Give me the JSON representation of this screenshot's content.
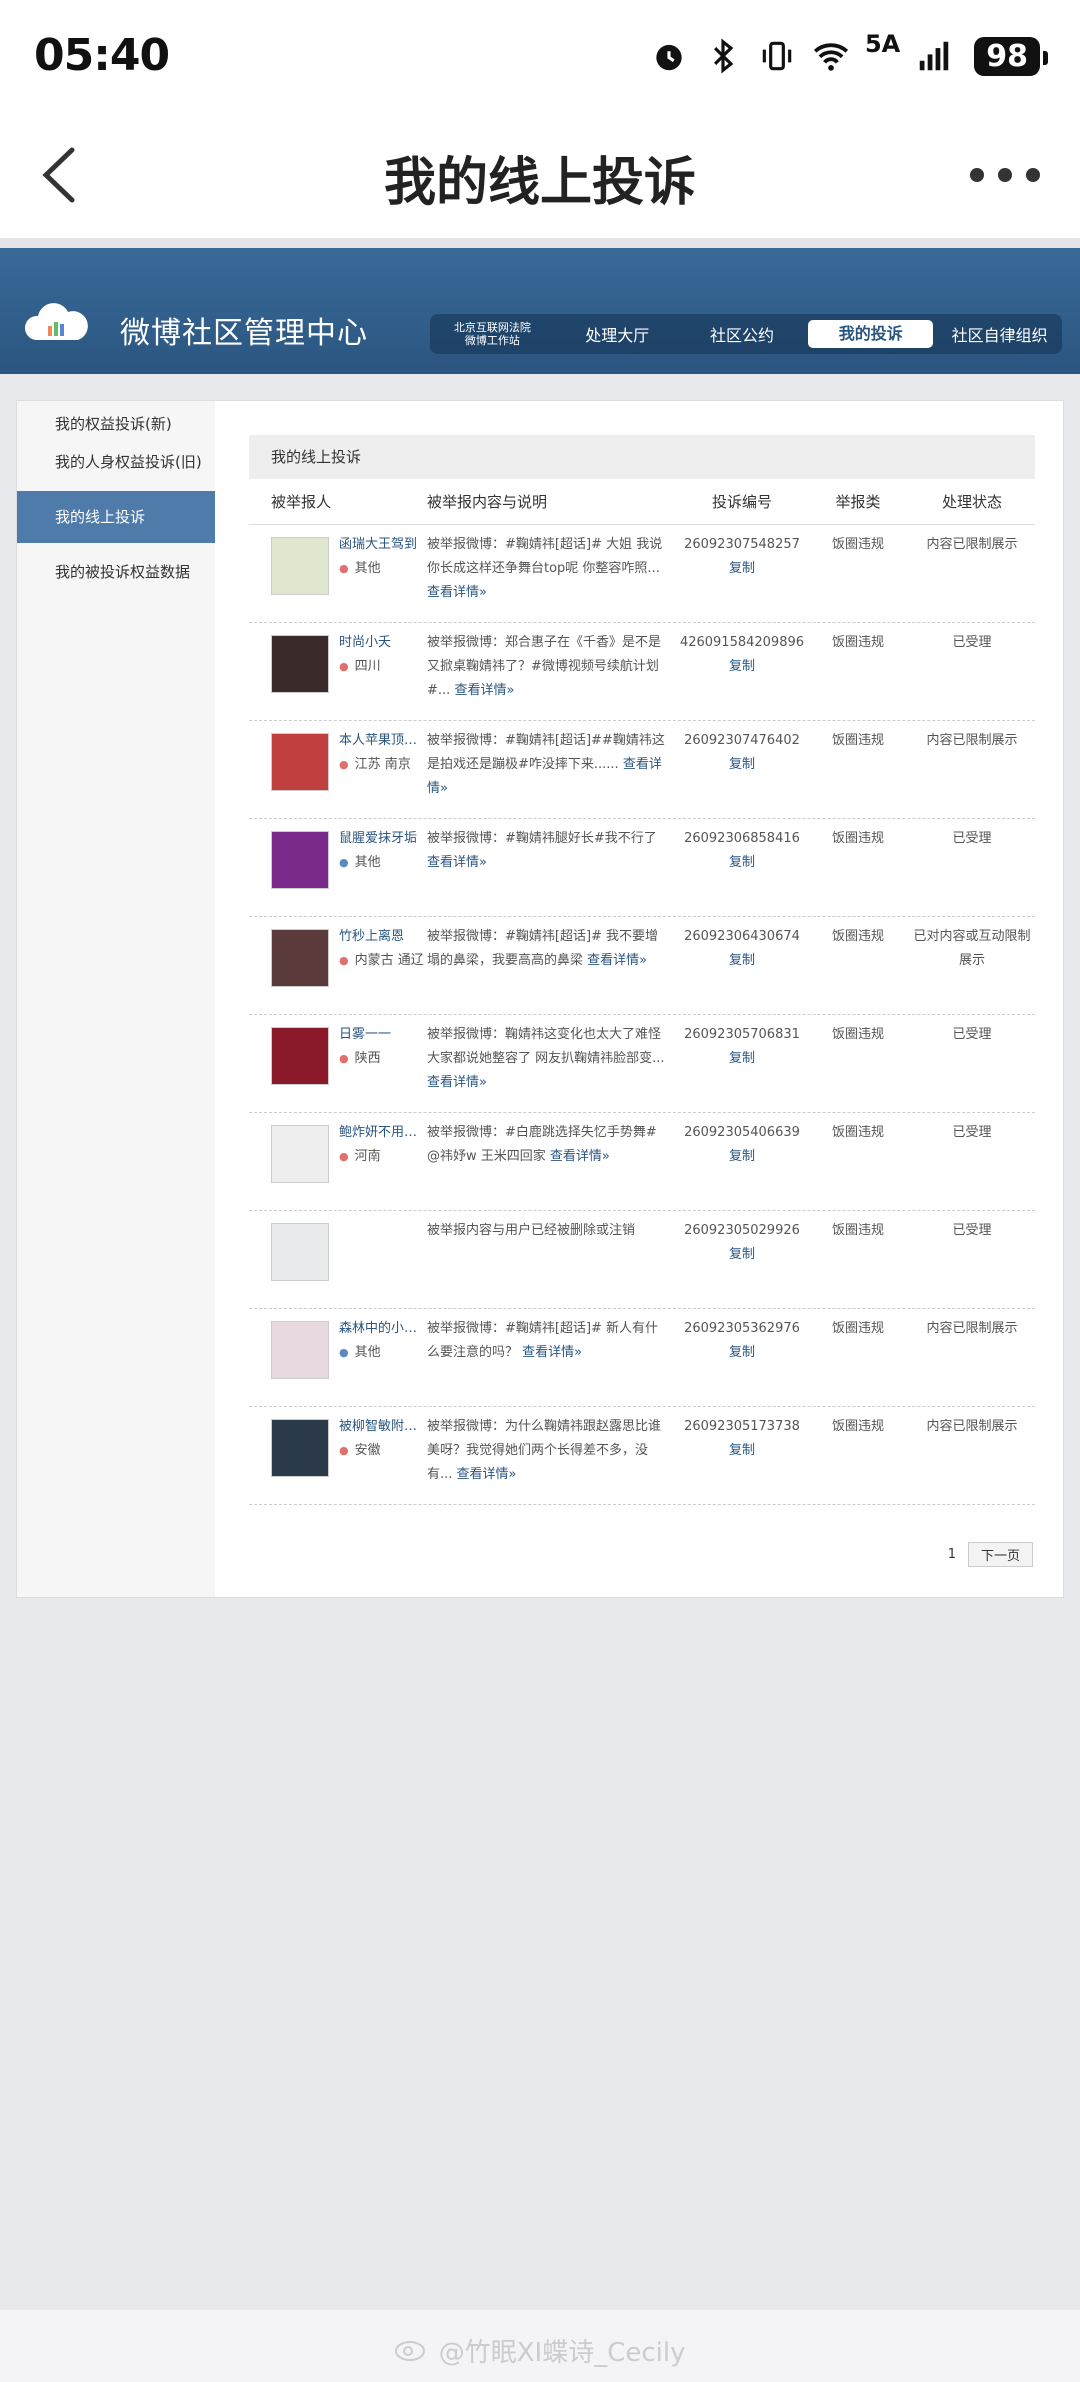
{
  "status": {
    "time": "05:40",
    "network": "5A",
    "battery": "98"
  },
  "nav": {
    "title": "我的线上投诉"
  },
  "web": {
    "title": "微博社区管理中心",
    "menu": [
      {
        "label_line1": "北京互联网法院",
        "label_line2": "微博工作站"
      },
      {
        "label": "处理大厅"
      },
      {
        "label": "社区公约"
      },
      {
        "label": "我的投诉"
      },
      {
        "label": "社区自律组织"
      }
    ]
  },
  "sidebar": {
    "items": [
      {
        "label": "我的权益投诉(新)"
      },
      {
        "label": "我的人身权益投诉(旧)"
      },
      {
        "label": "我的线上投诉"
      },
      {
        "label": "我的被投诉权益数据"
      }
    ]
  },
  "main": {
    "heading": "我的线上投诉",
    "columns": [
      "被举报人",
      "被举报内容与说明",
      "投诉编号",
      "举报类",
      "处理状态"
    ]
  },
  "rows": [
    {
      "name": "函瑞大王驾到",
      "loc": "其他",
      "desc": "被举报微博：#鞠婧祎[超话]# 大姐 我说你长成这样还争舞台top呢 你整容咋照...",
      "more": "查看详情»",
      "id": "26092307548257",
      "copy": "复制",
      "type": "饭圈违规",
      "status": "内容已限制展示"
    },
    {
      "name": "时尚小夭",
      "loc": "四川",
      "desc": "被举报微博：郑合惠子在《千香》是不是又掀桌鞠婧祎了？#微博视频号续航计划#...",
      "more": "查看详情»",
      "id": "426091584209896",
      "copy": "复制",
      "type": "饭圈违规",
      "status": "已受理"
    },
    {
      "name": "本人苹果顶配...",
      "loc": "江苏 南京",
      "desc": "被举报微博：#鞠婧祎[超话]##鞠婧祎这是拍戏还是蹦极#咋没摔下来......",
      "more": "查看详情»",
      "id": "26092307476402",
      "copy": "复制",
      "type": "饭圈违规",
      "status": "内容已限制展示"
    },
    {
      "name": "鼠腥爱抹牙垢",
      "loc": "其他",
      "desc": "被举报微博：#鞠婧祎腿好长#我不行了",
      "more": "查看详情»",
      "id": "26092306858416",
      "copy": "复制",
      "type": "饭圈违规",
      "status": "已受理"
    },
    {
      "name": "竹秒上离恩",
      "loc": "内蒙古 通辽",
      "desc": "被举报微博：#鞠婧祎[超话]# 我不要增塌的鼻梁，我要高高的鼻梁",
      "more": "查看详情»",
      "id": "26092306430674",
      "copy": "复制",
      "type": "饭圈违规",
      "status": "已对内容或互动限制展示"
    },
    {
      "name": "日雾一一",
      "loc": "陕西",
      "desc": "被举报微博：鞠婧祎这变化也太大了难怪大家都说她整容了 网友扒鞠婧祎脸部变...",
      "more": "查看详情»",
      "id": "26092305706831",
      "copy": "复制",
      "type": "饭圈违规",
      "status": "已受理"
    },
    {
      "name": "鲍炸妍不用爆...",
      "loc": "河南",
      "desc": "被举报微博：#白鹿跳选择失忆手势舞# @祎妤w 王米四回家",
      "more": "查看详情»",
      "id": "26092305406639",
      "copy": "复制",
      "type": "饭圈违规",
      "status": "已受理"
    },
    {
      "name": "",
      "loc": "",
      "desc": "被举报内容与用户已经被删除或注销",
      "more": "",
      "id": "26092305029926",
      "copy": "复制",
      "type": "饭圈违规",
      "status": "已受理"
    },
    {
      "name": "森林中的小露...",
      "loc": "其他",
      "desc": "被举报微博：#鞠婧祎[超话]# 新人有什么要注意的吗？",
      "more": "查看详情»",
      "id": "26092305362976",
      "copy": "复制",
      "type": "饭圈违规",
      "status": "内容已限制展示"
    },
    {
      "name": "被柳智敏附身了",
      "loc": "安徽",
      "desc": "被举报微博：为什么鞠婧祎跟赵露思比谁美呀？我觉得她们两个长得差不多，没有...",
      "more": "查看详情»",
      "id": "26092305173738",
      "copy": "复制",
      "type": "饭圈违规",
      "status": "内容已限制展示"
    }
  ],
  "pager": {
    "page": "1",
    "next": "下一页"
  },
  "watermark": "@竹眠XI蝶诗_Cecily",
  "colors": {
    "header_blue": "#2a5580",
    "active_side": "#4f7bab",
    "link": "#2a5580"
  }
}
